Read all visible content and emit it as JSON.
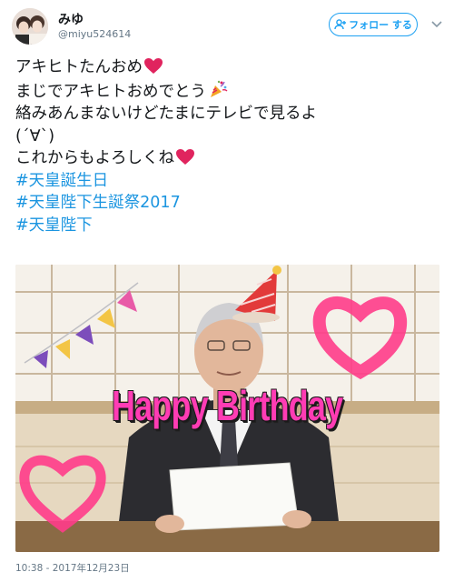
{
  "user": {
    "display_name": "みゆ",
    "handle": "@miyu524614"
  },
  "follow_button": {
    "label": "フォロー する"
  },
  "tweet": {
    "lines": [
      "アキヒトたんおめ",
      "まじでアキヒトおめでとう",
      "絡みあんまないけどたまにテレビで見るよ",
      "(´∀`)",
      "これからもよろしくね"
    ],
    "hashtags": [
      "#天皇誕生日",
      "#天皇陛下生誕祭2017",
      "#天皇陛下"
    ]
  },
  "photo": {
    "overlay_text": "Happy Birthday"
  },
  "timestamp": "10:38 - 2017年12月23日",
  "colors": {
    "accent": "#1da1f2",
    "hashtag": "#1b95e0",
    "heart": "#e0245e",
    "overlay_pink": "#ff3cb4"
  },
  "icons": [
    "avatar",
    "follow-user-icon",
    "chevron-down-icon",
    "red-heart-emoji",
    "party-popper-emoji",
    "party-hat",
    "bunting",
    "heart-drawing"
  ]
}
